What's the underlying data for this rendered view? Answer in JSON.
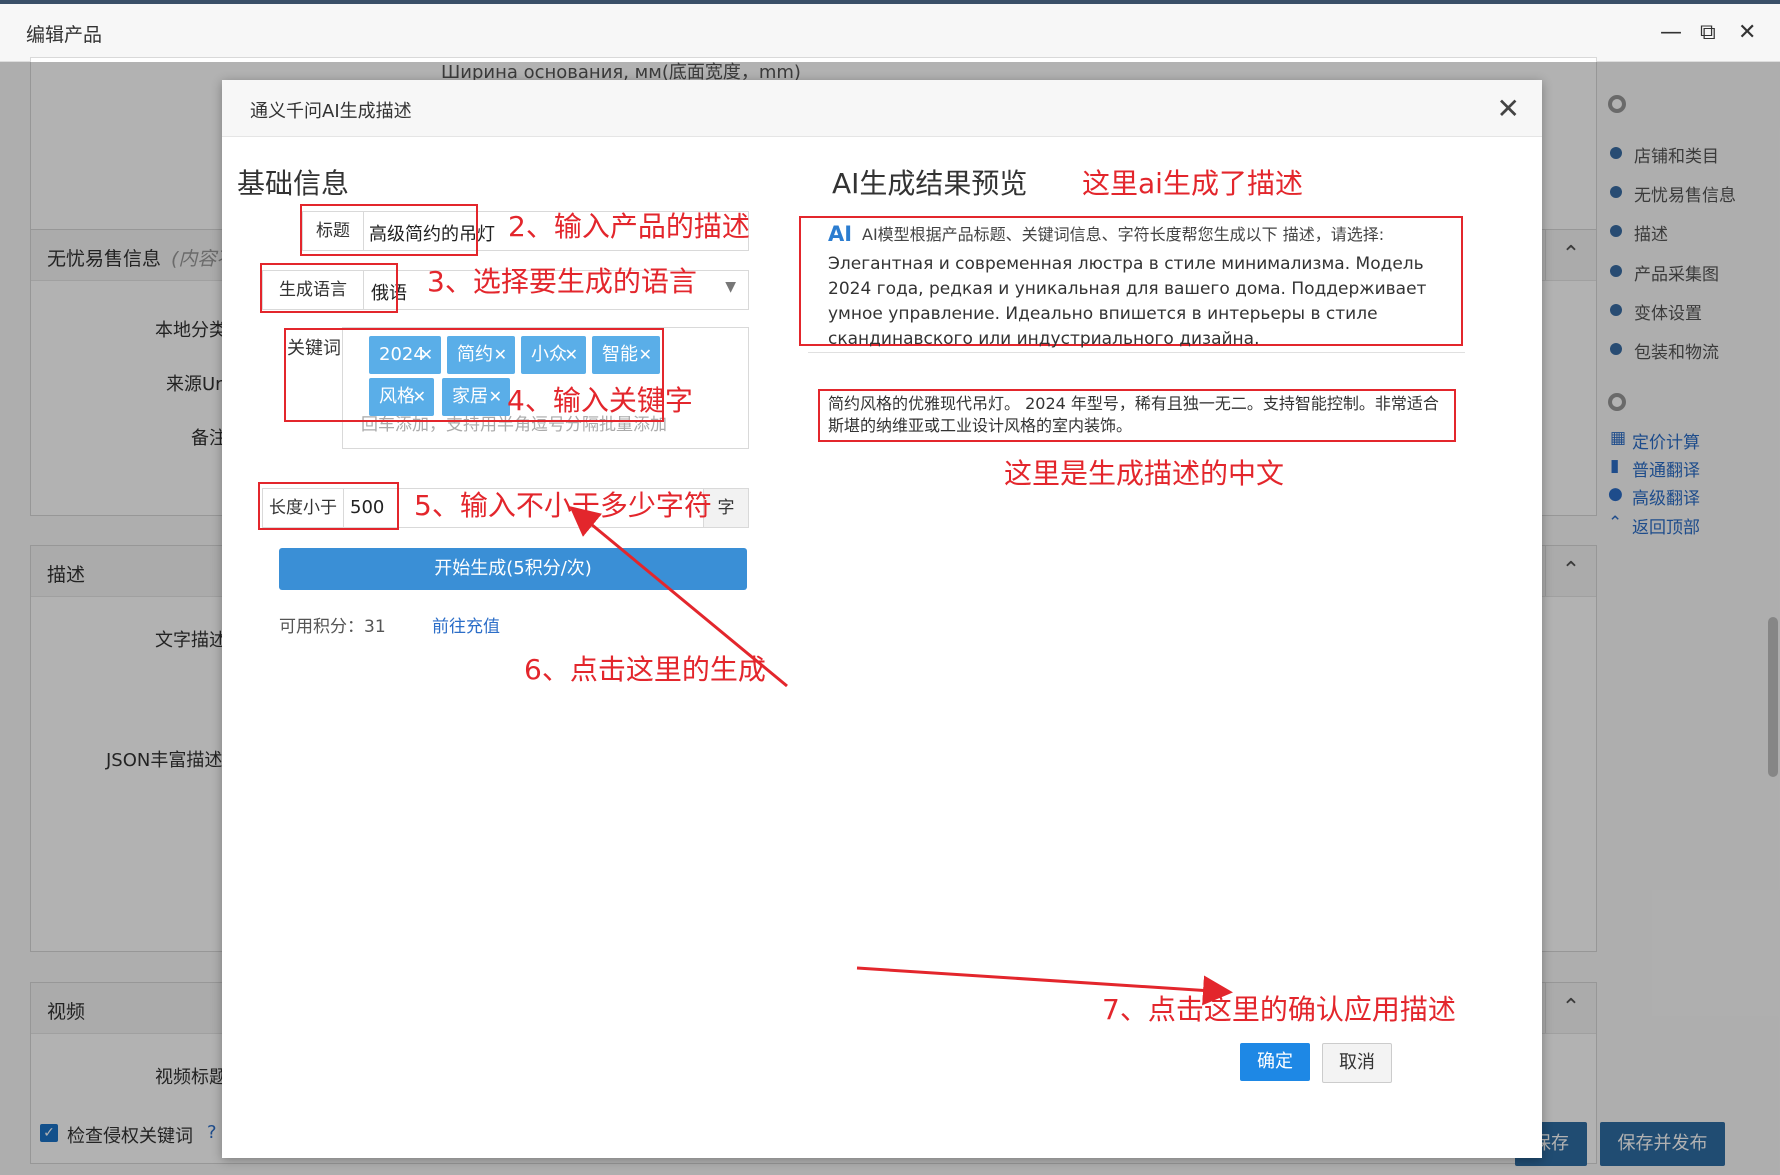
{
  "window": {
    "title": "编辑产品"
  },
  "background": {
    "top_label": "Ширина основания, мм(底面宽度，mm)",
    "panels": [
      {
        "title": "无忧易售信息",
        "subtitle": "(内容不",
        "fields": [
          "本地分类",
          "来源Url",
          "备注"
        ]
      },
      {
        "title": "描述",
        "fields": [
          "文字描述",
          "JSON丰富描述"
        ]
      },
      {
        "title": "视频",
        "fields": [
          "视频标题"
        ]
      }
    ],
    "checkbox_label": "检查侵权关键词",
    "save_label": "保存",
    "save_publish_label": "保存并发布"
  },
  "nav": {
    "items": [
      "店铺和类目",
      "无忧易售信息",
      "描述",
      "产品采集图",
      "变体设置",
      "包装和物流"
    ],
    "links": [
      "定价计算",
      "普通翻译",
      "高级翻译",
      "返回顶部"
    ]
  },
  "modal": {
    "title": "通义千问AI生成描述",
    "left_heading": "基础信息",
    "title_label": "标题",
    "title_value": "高级简约的吊灯",
    "lang_label": "生成语言",
    "lang_value": "俄语",
    "keywords_label": "关键词",
    "keywords": [
      "2024",
      "简约",
      "小众",
      "智能",
      "风格",
      "家居"
    ],
    "keywords_placeholder": "回车添加，支持用半角逗号分隔批量添加",
    "length_label": "长度小于",
    "length_value": "500",
    "length_unit": "字",
    "generate_label": "开始生成(5积分/次)",
    "credits_label": "可用积分：31",
    "recharge_label": "前往充值",
    "right_heading": "AI生成结果预览",
    "ai_badge": "AI",
    "ai_intro": "AI模型根据产品标题、关键词信息、字符长度帮您生成以下 描述，请选择:",
    "ru_text": "Элегантная и современная люстра в стиле минимализма. Модель 2024 года, редкая и уникальная для вашего дома. Поддерживает умное управление. Идеально впишется в интерьеры в стиле скандинавского или индустриального дизайна.",
    "zh_text": "简约风格的优雅现代吊灯。 2024 年型号，稀有且独一无二。支持智能控制。非常适合斯堪的纳维亚或工业设计风格的室内装饰。",
    "confirm_label": "确定",
    "cancel_label": "取消"
  },
  "annotations": {
    "a1": "这里ai生成了描述",
    "a2": "2、输入产品的描述",
    "a3": "3、选择要生成的语言",
    "a4": "4、输入关键字",
    "a5": "5、输入不小于多少字符",
    "a6": "6、点击这里的生成",
    "a7": "这里是生成描述的中文",
    "a8": "7、点击这里的确认应用描述"
  },
  "colors": {
    "accent": "#3a8fd6",
    "annotation": "#e3262c",
    "tag": "#5aaee8"
  }
}
